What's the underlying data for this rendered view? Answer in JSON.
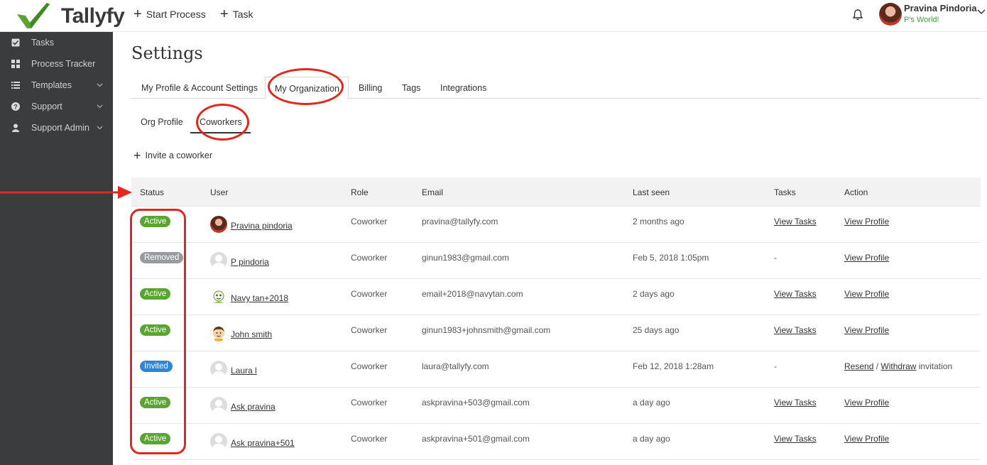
{
  "app": {
    "brand": "Tallyfy",
    "top_actions": [
      "Start Process",
      "Task"
    ],
    "user": {
      "name": "Pravina Pindoria",
      "org": "P's World!"
    }
  },
  "sidebar": {
    "items": [
      {
        "label": "Tasks",
        "icon": "check-square-icon",
        "chevron": false
      },
      {
        "label": "Process Tracker",
        "icon": "grid-icon",
        "chevron": false
      },
      {
        "label": "Templates",
        "icon": "list-icon",
        "chevron": true
      },
      {
        "label": "Support",
        "icon": "question-circle-icon",
        "chevron": true
      },
      {
        "label": "Support Admin",
        "icon": "user-icon",
        "chevron": true
      }
    ]
  },
  "page": {
    "title": "Settings",
    "tabs": [
      "My Profile & Account Settings",
      "My Organization",
      "Billing",
      "Tags",
      "Integrations"
    ],
    "active_tab": "My Organization",
    "subtabs": [
      "Org Profile",
      "Coworkers"
    ],
    "active_subtab": "Coworkers",
    "invite_label": "Invite a coworker"
  },
  "table": {
    "headers": [
      "Status",
      "User",
      "Role",
      "Email",
      "Last seen",
      "Tasks",
      "Action"
    ],
    "rows": [
      {
        "status": "Active",
        "user": "Pravina pindoria",
        "role": "Coworker",
        "email": "pravina@tallyfy.com",
        "last_seen": "2 months ago",
        "tasks": "View Tasks",
        "action": "View Profile",
        "avatar": "photo"
      },
      {
        "status": "Removed",
        "user": "P pindoria",
        "role": "Coworker",
        "email": "ginun1983@gmail.com",
        "last_seen": "Feb 5, 2018 1:05pm",
        "tasks": "-",
        "action": "View Profile",
        "avatar": "generic"
      },
      {
        "status": "Active",
        "user": "Navy tan+2018",
        "role": "Coworker",
        "email": "email+2018@navytan.com",
        "last_seen": "2 days ago",
        "tasks": "View Tasks",
        "action": "View Profile",
        "avatar": "cartoon-green"
      },
      {
        "status": "Active",
        "user": "John smith",
        "role": "Coworker",
        "email": "ginun1983+johnsmith@gmail.com",
        "last_seen": "25 days ago",
        "tasks": "View Tasks",
        "action": "View Profile",
        "avatar": "cartoon-face"
      },
      {
        "status": "Invited",
        "user": "Laura l",
        "role": "Coworker",
        "email": "laura@tallyfy.com",
        "last_seen": "Feb 12, 2018 1:28am",
        "tasks": "-",
        "action_resend": "Resend",
        "action_sep": "/",
        "action_withdraw": "Withdraw",
        "action_suffix": "invitation",
        "avatar": "generic"
      },
      {
        "status": "Active",
        "user": "Ask pravina",
        "role": "Coworker",
        "email": "askpravina+503@gmail.com",
        "last_seen": "a day ago",
        "tasks": "View Tasks",
        "action": "View Profile",
        "avatar": "generic"
      },
      {
        "status": "Active",
        "user": "Ask pravina+501",
        "role": "Coworker",
        "email": "askpravina+501@gmail.com",
        "last_seen": "a day ago",
        "tasks": "View Tasks",
        "action": "View Profile",
        "avatar": "generic"
      }
    ]
  },
  "colors": {
    "active": "#5aa532",
    "removed": "#999a9e",
    "invited": "#2f86d6",
    "annotation": "#e0281e",
    "sidebar_bg": "#3b3c3d"
  }
}
